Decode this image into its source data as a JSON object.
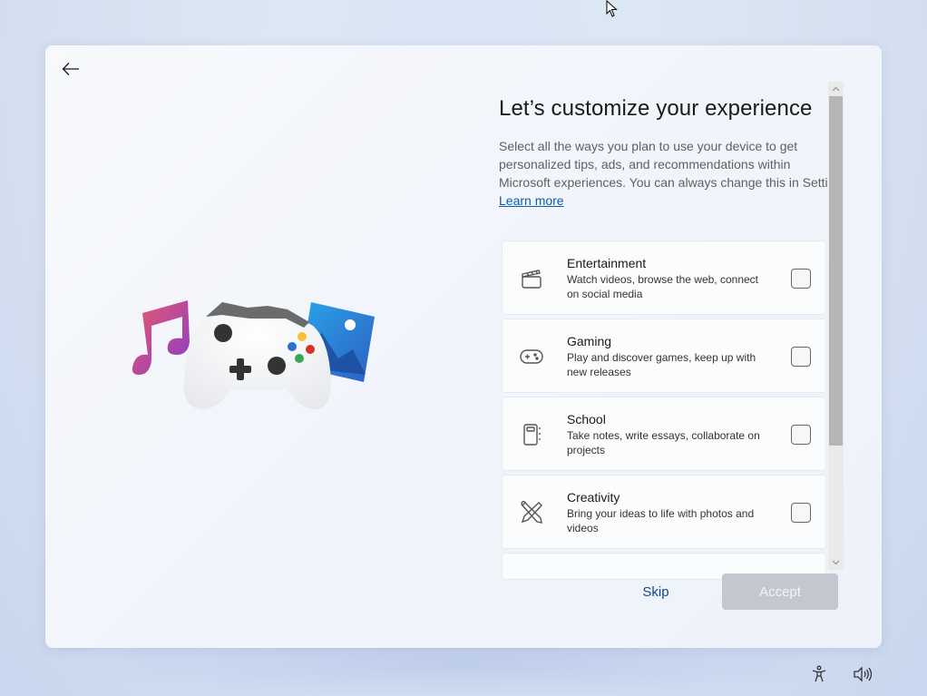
{
  "page": {
    "title": "Let’s customize your experience",
    "description_lines": [
      "Select all the ways you plan to use your device to get",
      "personalized tips, ads, and recommendations within",
      "Microsoft experiences. You can always change this in Settings."
    ],
    "learn_more": "Learn more"
  },
  "options": [
    {
      "title": "Entertainment",
      "subtitle_lines": [
        "Watch videos, browse the web, connect",
        "on social media"
      ],
      "icon": "clapperboard-icon",
      "checked": false
    },
    {
      "title": "Gaming",
      "subtitle_lines": [
        "Play and discover games, keep up with",
        "new releases"
      ],
      "icon": "gamepad-icon",
      "checked": false
    },
    {
      "title": "School",
      "subtitle_lines": [
        "Take notes, write essays, collaborate on",
        "projects"
      ],
      "icon": "notebook-icon",
      "checked": false
    },
    {
      "title": "Creativity",
      "subtitle_lines": [
        "Bring your ideas to life with photos and",
        "videos"
      ],
      "icon": "pen-brush-icon",
      "checked": false
    }
  ],
  "buttons": {
    "skip": "Skip",
    "accept": "Accept",
    "accept_enabled": false
  },
  "hero_icons": [
    "music-note-icon",
    "game-controller-icon",
    "photos-icon"
  ],
  "tray": [
    "accessibility-icon",
    "volume-icon"
  ],
  "colors": {
    "link": "#0b5cab",
    "skip": "#0b4a8b",
    "accept_disabled_bg": "#c4c8ce"
  }
}
